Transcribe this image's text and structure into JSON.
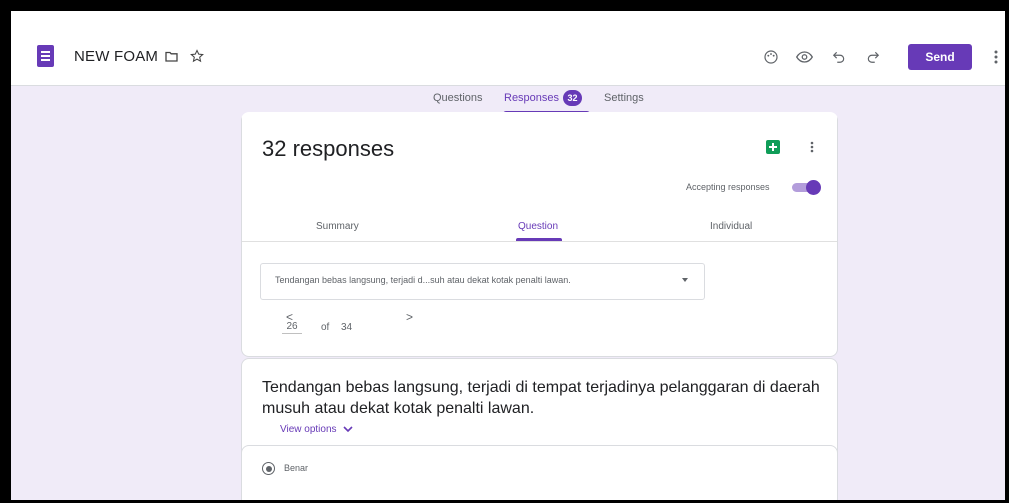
{
  "header": {
    "doc_title": "NEW FOAM",
    "send_label": "Send",
    "icons": [
      "folder-icon",
      "star-icon",
      "palette-icon",
      "preview-eye-icon",
      "undo-icon",
      "redo-icon",
      "more-vert-icon"
    ]
  },
  "tabs": [
    {
      "label": "Questions",
      "active": false
    },
    {
      "label": "Responses",
      "active": true,
      "badge": "32"
    },
    {
      "label": "Settings",
      "active": false
    }
  ],
  "summary_card": {
    "count_text": "32 responses",
    "accepting_label": "Accepting responses",
    "accepting_on": true,
    "subtabs": [
      {
        "label": "Summary",
        "active": false
      },
      {
        "label": "Question",
        "active": true
      },
      {
        "label": "Individual",
        "active": false
      }
    ],
    "question_select_value": "Tendangan bebas langsung, terjadi d...suh atau dekat kotak penalti lawan.",
    "pager": {
      "current": "26",
      "of_label": "of",
      "total": "34",
      "prev": "<",
      "next": ">"
    }
  },
  "question_card": {
    "title": "Tendangan bebas langsung, terjadi di tempat terjadinya pelanggaran di daerah musuh atau dekat kotak penalti lawan.",
    "view_options_label": "View options"
  },
  "answer_card": {
    "option_label": "Benar",
    "selected": true
  },
  "colors": {
    "accent": "#673ab7",
    "background": "#f0ebf8",
    "sheets_green": "#0f9d58"
  }
}
